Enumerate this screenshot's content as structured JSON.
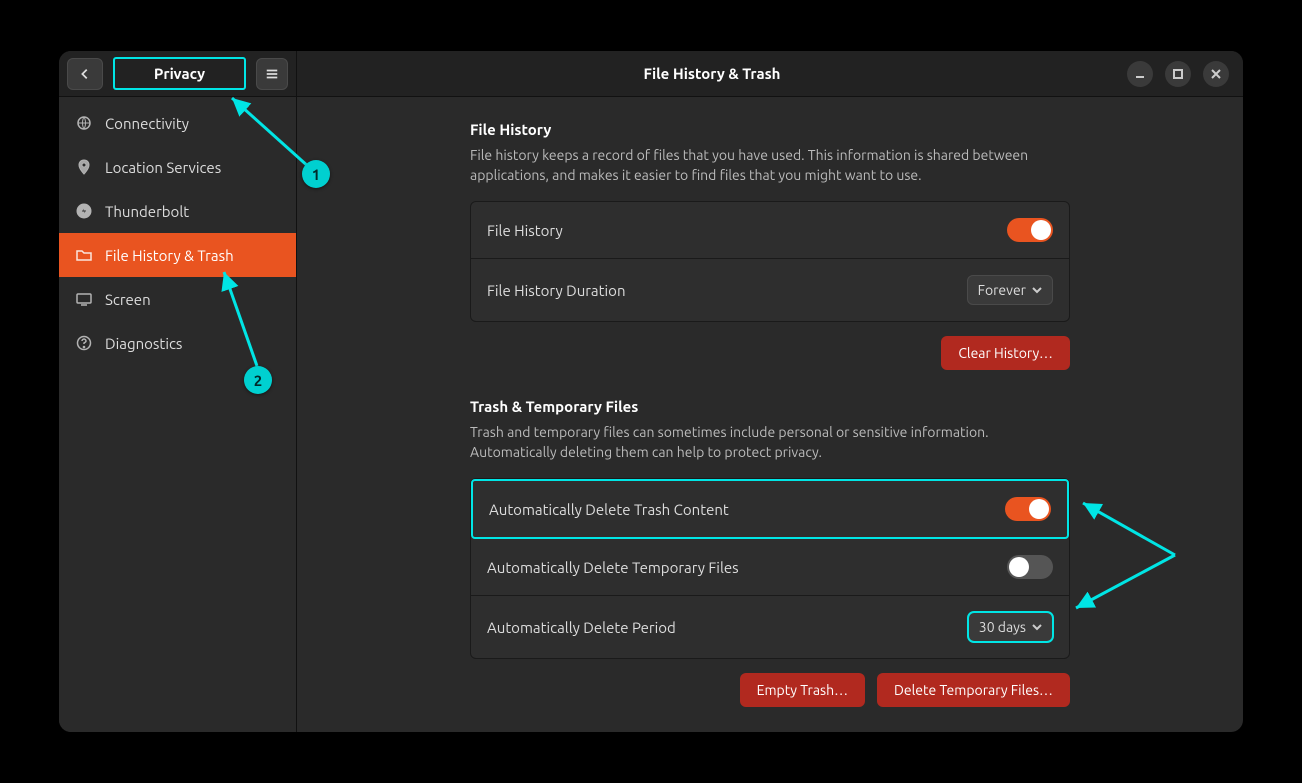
{
  "header": {
    "back_section": "Privacy",
    "title": "File History & Trash"
  },
  "sidebar": {
    "items": [
      {
        "label": "Connectivity"
      },
      {
        "label": "Location Services"
      },
      {
        "label": "Thunderbolt"
      },
      {
        "label": "File History & Trash"
      },
      {
        "label": "Screen"
      },
      {
        "label": "Diagnostics"
      }
    ],
    "active_index": 3
  },
  "sections": {
    "file_history": {
      "title": "File History",
      "description": "File history keeps a record of files that you have used. This information is shared between applications, and makes it easier to find files that you might want to use.",
      "rows": {
        "enable": {
          "label": "File History",
          "value": true
        },
        "duration": {
          "label": "File History Duration",
          "value": "Forever"
        }
      },
      "clear_btn": "Clear History…"
    },
    "trash": {
      "title": "Trash & Temporary Files",
      "description": "Trash and temporary files can sometimes include personal or sensitive information. Automatically deleting them can help to protect privacy.",
      "rows": {
        "auto_trash": {
          "label": "Automatically Delete Trash Content",
          "value": true
        },
        "auto_temp": {
          "label": "Automatically Delete Temporary Files",
          "value": false
        },
        "period": {
          "label": "Automatically Delete Period",
          "value": "30 days"
        }
      },
      "empty_btn": "Empty Trash…",
      "delete_temp_btn": "Delete Temporary Files…"
    }
  },
  "annotations": {
    "badge1": "1",
    "badge2": "2"
  }
}
